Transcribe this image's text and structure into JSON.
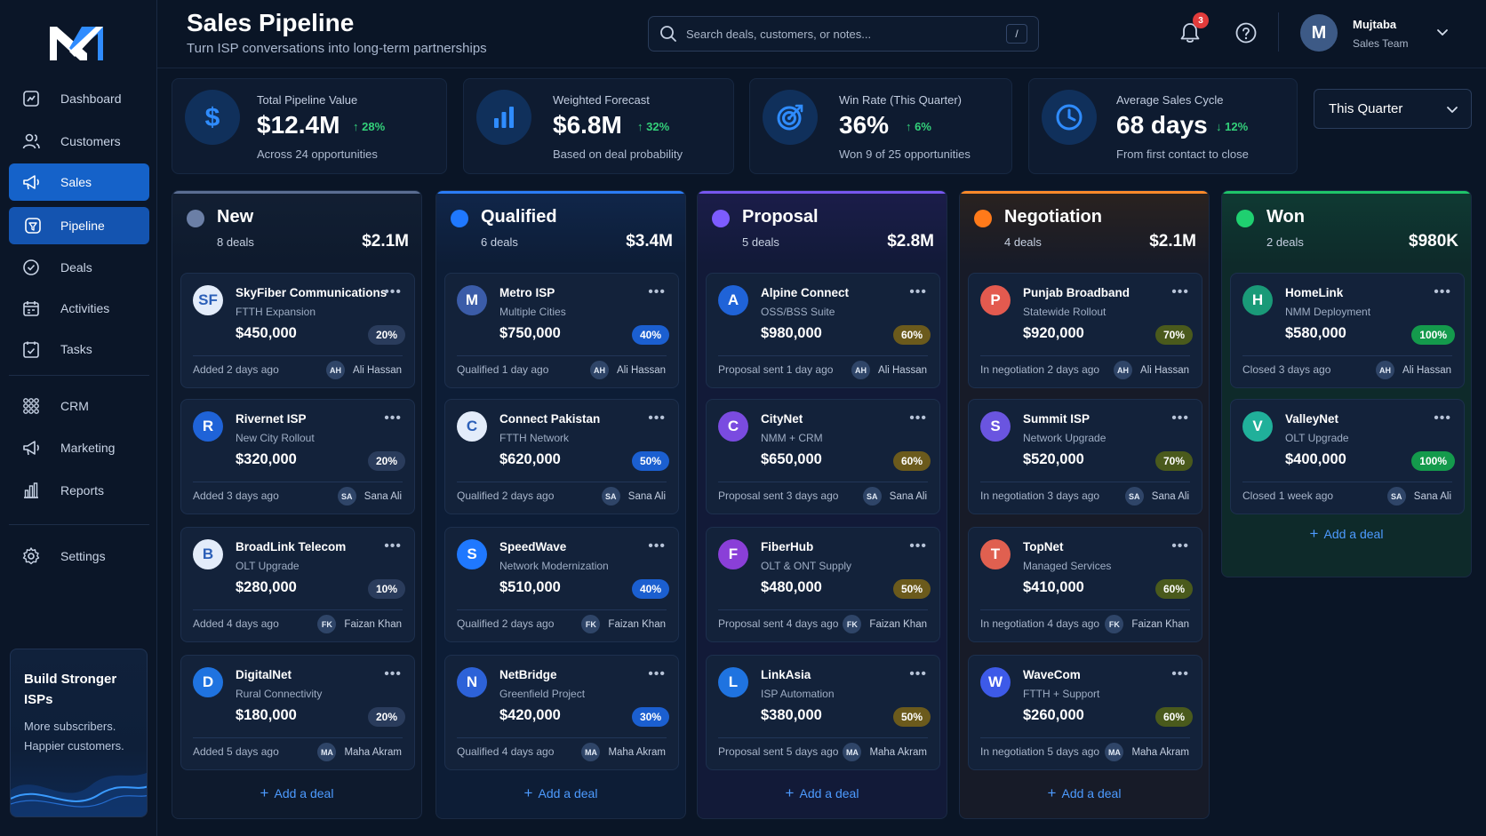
{
  "header": {
    "title": "Sales Pipeline",
    "subtitle": "Turn ISP conversations into long-term partnerships",
    "search_placeholder": "Search deals, customers, or notes...",
    "search_shortcut": "/",
    "notification_count": "3",
    "user": {
      "initial": "M",
      "name": "Mujtaba",
      "role": "Sales Team"
    }
  },
  "sidebar": {
    "items": [
      {
        "label": "Dashboard",
        "icon": "dashboard-icon"
      },
      {
        "label": "Customers",
        "icon": "users-icon"
      },
      {
        "label": "Sales",
        "icon": "megaphone-icon"
      },
      {
        "label": "Pipeline",
        "icon": "pipeline-icon"
      },
      {
        "label": "Deals",
        "icon": "deals-icon"
      },
      {
        "label": "Activities",
        "icon": "calendar-icon"
      },
      {
        "label": "Tasks",
        "icon": "tasks-icon"
      },
      {
        "label": "CRM",
        "icon": "grid-icon"
      },
      {
        "label": "Marketing",
        "icon": "megaphone-icon"
      },
      {
        "label": "Reports",
        "icon": "bar-chart-icon"
      },
      {
        "label": "Settings",
        "icon": "gear-icon"
      }
    ],
    "promo": {
      "title": "Build Stronger ISPs",
      "text": "More subscribers. Happier customers."
    }
  },
  "stats": [
    {
      "label": "Total Pipeline Value",
      "value": "$12.4M",
      "trend": "↑ 28%",
      "sub": "Across 24 opportunities",
      "icon": "dollar-icon",
      "trend_color": "#33d17a"
    },
    {
      "label": "Weighted Forecast",
      "value": "$6.8M",
      "trend": "↑ 32%",
      "sub": "Based on deal probability",
      "icon": "bar-chart-icon",
      "trend_color": "#33d17a"
    },
    {
      "label": "Win Rate (This Quarter)",
      "value": "36%",
      "trend": "↑ 6%",
      "sub": "Won 9 of 25 opportunities",
      "icon": "target-icon",
      "trend_color": "#33d17a"
    },
    {
      "label": "Average Sales Cycle",
      "value": "68 days",
      "trend": "↓ 12%",
      "sub": "From first contact to close",
      "icon": "clock-icon",
      "trend_color": "#33d17a"
    }
  ],
  "period": {
    "value": "This Quarter"
  },
  "add_label": "Add a deal",
  "columns": [
    {
      "name": "New",
      "count": "8 deals",
      "total": "$2.1M",
      "color": "#6b7fa6",
      "bar": "#5a6d92",
      "head": "#121f33",
      "body": "#0e1a2d",
      "pill": "#2a3c5c",
      "deals": [
        {
          "initials": "SF",
          "name": "SkyFiber Communications",
          "desc": "FTTH Expansion",
          "amount": "$450,000",
          "pct": "20%",
          "meta": "Added 2 days ago",
          "owner_initials": "AH",
          "owner": "Ali Hassan",
          "av": "#e3ecfa",
          "avtext": "#2b5fb8"
        },
        {
          "initials": "R",
          "name": "Rivernet ISP",
          "desc": "New City Rollout",
          "amount": "$320,000",
          "pct": "20%",
          "meta": "Added 3 days ago",
          "owner_initials": "SA",
          "owner": "Sana Ali",
          "av": "#1f63d8",
          "avtext": "#ffffff"
        },
        {
          "initials": "B",
          "name": "BroadLink Telecom",
          "desc": "OLT Upgrade",
          "amount": "$280,000",
          "pct": "10%",
          "meta": "Added 4 days ago",
          "owner_initials": "FK",
          "owner": "Faizan Khan",
          "av": "#e3ecfa",
          "avtext": "#2b5fb8"
        },
        {
          "initials": "D",
          "name": "DigitalNet",
          "desc": "Rural Connectivity",
          "amount": "$180,000",
          "pct": "20%",
          "meta": "Added 5 days ago",
          "owner_initials": "MA",
          "owner": "Maha Akram",
          "av": "#1f73e0",
          "avtext": "#ffffff"
        }
      ]
    },
    {
      "name": "Qualified",
      "count": "6 deals",
      "total": "$3.4M",
      "color": "#1f78ff",
      "bar": "#2b7cf6",
      "head": "#10264a",
      "body": "#0d1d36",
      "pill": "#1b5fd0",
      "deals": [
        {
          "initials": "M",
          "name": "Metro ISP",
          "desc": "Multiple Cities",
          "amount": "$750,000",
          "pct": "40%",
          "meta": "Qualified 1 day ago",
          "owner_initials": "AH",
          "owner": "Ali Hassan",
          "av": "#3b5ca8",
          "avtext": "#ffffff"
        },
        {
          "initials": "C",
          "name": "Connect Pakistan",
          "desc": "FTTH Network",
          "amount": "$620,000",
          "pct": "50%",
          "meta": "Qualified 2 days ago",
          "owner_initials": "SA",
          "owner": "Sana Ali",
          "av": "#e3ecfa",
          "avtext": "#2b5fb8"
        },
        {
          "initials": "S",
          "name": "SpeedWave",
          "desc": "Network Modernization",
          "amount": "$510,000",
          "pct": "40%",
          "meta": "Qualified 2 days ago",
          "owner_initials": "FK",
          "owner": "Faizan Khan",
          "av": "#1f78ff",
          "avtext": "#ffffff"
        },
        {
          "initials": "N",
          "name": "NetBridge",
          "desc": "Greenfield Project",
          "amount": "$420,000",
          "pct": "30%",
          "meta": "Qualified 4 days ago",
          "owner_initials": "MA",
          "owner": "Maha Akram",
          "av": "#2d62d8",
          "avtext": "#ffffff"
        }
      ]
    },
    {
      "name": "Proposal",
      "count": "5 deals",
      "total": "$2.8M",
      "color": "#7d5cff",
      "bar": "#7757f0",
      "head": "#1b1d4a",
      "body": "#121a38",
      "pill": "#6b5a1c",
      "deals": [
        {
          "initials": "A",
          "name": "Alpine Connect",
          "desc": "OSS/BSS Suite",
          "amount": "$980,000",
          "pct": "60%",
          "meta": "Proposal sent 1 day ago",
          "owner_initials": "AH",
          "owner": "Ali Hassan",
          "av": "#1f63d8",
          "avtext": "#ffffff"
        },
        {
          "initials": "C",
          "name": "CityNet",
          "desc": "NMM + CRM",
          "amount": "$650,000",
          "pct": "60%",
          "meta": "Proposal sent 3 days ago",
          "owner_initials": "SA",
          "owner": "Sana Ali",
          "av": "#7a4be0",
          "avtext": "#ffffff"
        },
        {
          "initials": "F",
          "name": "FiberHub",
          "desc": "OLT & ONT Supply",
          "amount": "$480,000",
          "pct": "50%",
          "meta": "Proposal sent 4 days ago",
          "owner_initials": "FK",
          "owner": "Faizan Khan",
          "av": "#8a3fd8",
          "avtext": "#ffffff"
        },
        {
          "initials": "L",
          "name": "LinkAsia",
          "desc": "ISP Automation",
          "amount": "$380,000",
          "pct": "50%",
          "meta": "Proposal sent 5 days ago",
          "owner_initials": "MA",
          "owner": "Maha Akram",
          "av": "#1f73e0",
          "avtext": "#ffffff"
        }
      ]
    },
    {
      "name": "Negotiation",
      "count": "4 deals",
      "total": "$2.1M",
      "color": "#ff7a1a",
      "bar": "#ff8a2a",
      "head": "#2a221f",
      "body": "#171b28",
      "pill": "#4a5a1c",
      "deals": [
        {
          "initials": "P",
          "name": "Punjab Broadband",
          "desc": "Statewide Rollout",
          "amount": "$920,000",
          "pct": "70%",
          "meta": "In negotiation 2 days ago",
          "owner_initials": "AH",
          "owner": "Ali Hassan",
          "av": "#e35a4f",
          "avtext": "#ffffff"
        },
        {
          "initials": "S",
          "name": "Summit ISP",
          "desc": "Network Upgrade",
          "amount": "$520,000",
          "pct": "70%",
          "meta": "In negotiation 3 days ago",
          "owner_initials": "SA",
          "owner": "Sana Ali",
          "av": "#6a55e0",
          "avtext": "#ffffff"
        },
        {
          "initials": "T",
          "name": "TopNet",
          "desc": "Managed Services",
          "amount": "$410,000",
          "pct": "60%",
          "meta": "In negotiation 4 days ago",
          "owner_initials": "FK",
          "owner": "Faizan Khan",
          "av": "#e06050",
          "avtext": "#ffffff"
        },
        {
          "initials": "W",
          "name": "WaveCom",
          "desc": "FTTH + Support",
          "amount": "$260,000",
          "pct": "60%",
          "meta": "In negotiation 5 days ago",
          "owner_initials": "MA",
          "owner": "Maha Akram",
          "av": "#3d5ae8",
          "avtext": "#ffffff"
        }
      ]
    },
    {
      "name": "Won",
      "count": "2 deals",
      "total": "$980K",
      "color": "#1fd070",
      "bar": "#1fc46a",
      "head": "#0f3a33",
      "body": "#0e2a2a",
      "pill": "#149a4c",
      "deals": [
        {
          "initials": "H",
          "name": "HomeLink",
          "desc": "NMM Deployment",
          "amount": "$580,000",
          "pct": "100%",
          "meta": "Closed 3 days ago",
          "owner_initials": "AH",
          "owner": "Ali Hassan",
          "av": "#1a9a78",
          "avtext": "#ffffff"
        },
        {
          "initials": "V",
          "name": "ValleyNet",
          "desc": "OLT Upgrade",
          "amount": "$400,000",
          "pct": "100%",
          "meta": "Closed 1 week ago",
          "owner_initials": "SA",
          "owner": "Sana Ali",
          "av": "#20b09a",
          "avtext": "#ffffff"
        }
      ]
    }
  ]
}
